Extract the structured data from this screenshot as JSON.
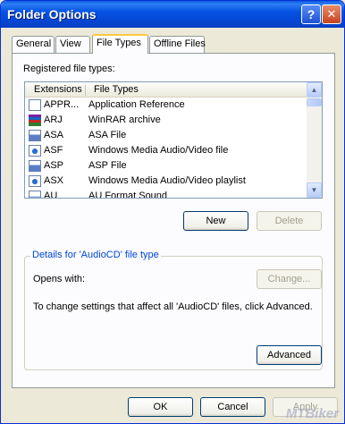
{
  "window": {
    "title": "Folder Options"
  },
  "titlebar": {
    "help_icon": "?",
    "close_icon": "✕"
  },
  "tabs": [
    {
      "label": "General"
    },
    {
      "label": "View"
    },
    {
      "label": "File Types"
    },
    {
      "label": "Offline Files"
    }
  ],
  "active_tab": "File Types",
  "registered": {
    "label": "Registered file types:",
    "columns": [
      "Extensions",
      "File Types"
    ],
    "rows": [
      {
        "ext": "APPR...",
        "type": "Application Reference",
        "icon": "blank-document-icon"
      },
      {
        "ext": "ARJ",
        "type": "WinRAR archive",
        "icon": "winrar-archive-icon"
      },
      {
        "ext": "ASA",
        "type": "ASA File",
        "icon": "generic-file-icon"
      },
      {
        "ext": "ASF",
        "type": "Windows Media Audio/Video file",
        "icon": "media-file-icon"
      },
      {
        "ext": "ASP",
        "type": "ASP File",
        "icon": "generic-file-icon"
      },
      {
        "ext": "ASX",
        "type": "Windows Media Audio/Video playlist",
        "icon": "media-file-icon"
      },
      {
        "ext": "AU",
        "type": "AU Format Sound",
        "icon": "sound-file-icon"
      }
    ]
  },
  "buttons": {
    "new": "New",
    "delete": "Delete",
    "change": "Change...",
    "advanced": "Advanced",
    "ok": "OK",
    "cancel": "Cancel",
    "apply": "Apply"
  },
  "details": {
    "title": "Details for 'AudioCD' file type",
    "opens_with_label": "Opens with:",
    "info": "To change settings that affect all 'AudioCD' files, click Advanced."
  },
  "watermark": "MTBiker",
  "colors": {
    "accent": "#0046d5",
    "titlebar": "#0554e3",
    "window_bg": "#ece9d8"
  }
}
